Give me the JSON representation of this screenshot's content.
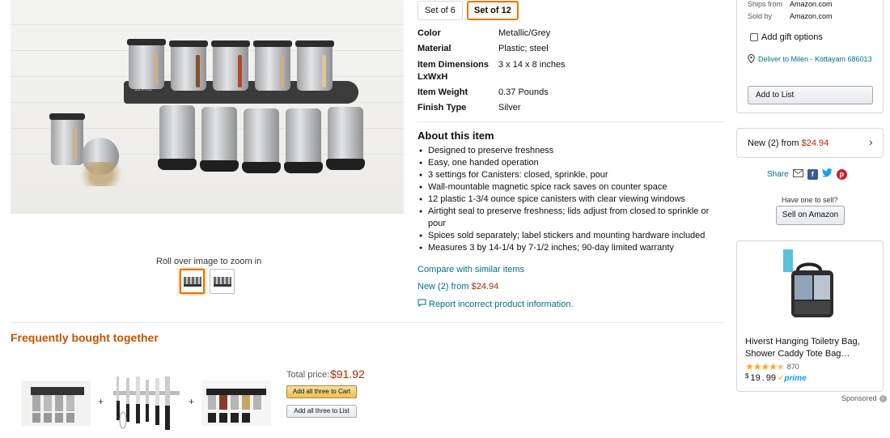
{
  "size_options": [
    "Set of 6",
    "Set of 12"
  ],
  "selected_size": "Set of 12",
  "specs": [
    {
      "key": "Color",
      "value": "Metallic/Grey"
    },
    {
      "key": "Material",
      "value": "Plastic; steel"
    },
    {
      "key": "Item Dimensions LxWxH",
      "value": "3 x 14 x 8 inches"
    },
    {
      "key": "Item Weight",
      "value": "0.37 Pounds"
    },
    {
      "key": "Finish Type",
      "value": "Silver"
    }
  ],
  "about": {
    "title": "About this item",
    "bullets": [
      "Designed to preserve freshness",
      "Easy, one handed operation",
      "3 settings for Canisters: closed, sprinkle, pour",
      "Wall-mountable magnetic spice rack saves on counter space",
      "12 plastic 1-3/4 ounce spice canisters with clear viewing windows",
      "Airtight seal to preserve freshness; lids adjust from closed to sprinkle or pour",
      "Spices sold separately; label stickers and mounting hardware included",
      "Measures 3 by 14-1/4 by 7-1/2 inches; 90-day limited warranty"
    ]
  },
  "links": {
    "compare": "Compare with similar items",
    "new_from_prefix": "New (2) from ",
    "new_from_price": "$24.94",
    "report": "Report incorrect product information."
  },
  "gallery": {
    "zoom_hint": "Roll over image to zoom in",
    "image_brand": "ZEVRO"
  },
  "buybox": {
    "ships_from_label": "Ships from",
    "ships_from_value": "Amazon.com",
    "sold_by_label": "Sold by",
    "sold_by_value": "Amazon.com",
    "gift_label": "Add gift options",
    "deliver_text": "Deliver to Milen - Kottayam 686013",
    "add_to_list": "Add to List"
  },
  "new_offers": {
    "prefix": "New (2) from ",
    "price": "$24.94"
  },
  "share": {
    "label": "Share"
  },
  "sell": {
    "question": "Have one to sell?",
    "button": "Sell on Amazon"
  },
  "ad": {
    "title": "Hiverst Hanging Toiletry Bag, Shower Caddy Tote Bag…",
    "rating": 4.5,
    "review_count": "870",
    "price_currency": "$",
    "price_whole": "19",
    "price_fraction": "99",
    "prime": "prime",
    "sponsored": "Sponsored"
  },
  "fbt": {
    "title": "Frequently bought together",
    "total_label": "Total price:",
    "total_value": "$91.92",
    "add_all_cart": "Add all three to Cart",
    "add_all_list": "Add all three to List",
    "plus": "+"
  },
  "colors": {
    "link": "#007185",
    "price": "#b12704",
    "fbt_title": "#c45500",
    "selected_border": "#e77600",
    "star": "#ffa41c"
  }
}
